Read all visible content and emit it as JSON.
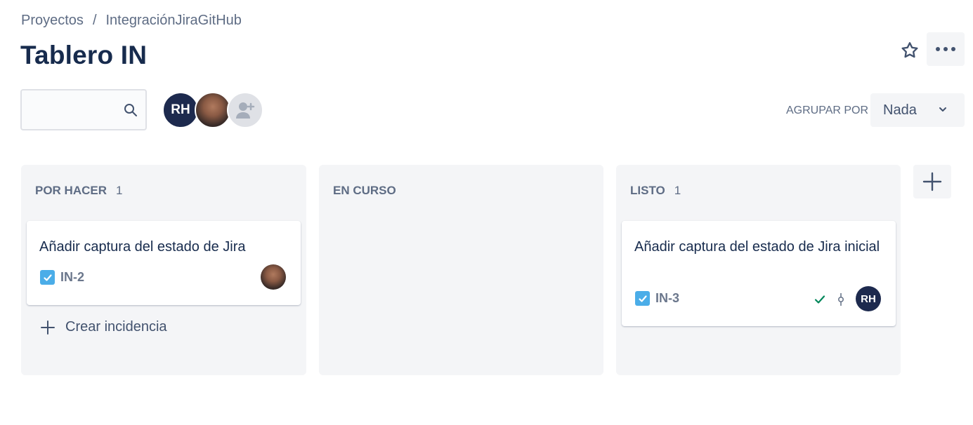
{
  "breadcrumb": {
    "items": [
      "Proyectos",
      "IntegraciónJiraGitHub"
    ],
    "separator": "/"
  },
  "page_title": "Tablero IN",
  "header_actions": {
    "star_icon": "star-icon",
    "more_icon": "more-horizontal-icon"
  },
  "search": {
    "value": "",
    "placeholder": "",
    "icon": "search-icon"
  },
  "avatars": [
    {
      "initials": "RH",
      "type": "initials"
    },
    {
      "type": "photo"
    },
    {
      "type": "add-people",
      "icon": "add-user-icon"
    }
  ],
  "group_by": {
    "label": "AGRUPAR POR",
    "selected": "Nada"
  },
  "columns": [
    {
      "title": "POR HACER",
      "count": "1",
      "cards": [
        {
          "summary": "Añadir captura del estado de Jira",
          "key": "IN-2",
          "assignee": "photo"
        }
      ],
      "create_label": "Crear incidencia"
    },
    {
      "title": "EN CURSO",
      "count": "",
      "cards": []
    },
    {
      "title": "LISTO",
      "count": "1",
      "cards": [
        {
          "summary": "Añadir captura del estado de Jira inicial",
          "key": "IN-3",
          "assignee": "RH"
        }
      ]
    }
  ],
  "colors": {
    "primary_text": "#172b4d",
    "secondary_text": "#5e6c84",
    "column_bg": "#f4f5f7",
    "task_icon": "#4bade8",
    "done_check": "#00875a",
    "avatar_dark": "#1d2a4e"
  }
}
